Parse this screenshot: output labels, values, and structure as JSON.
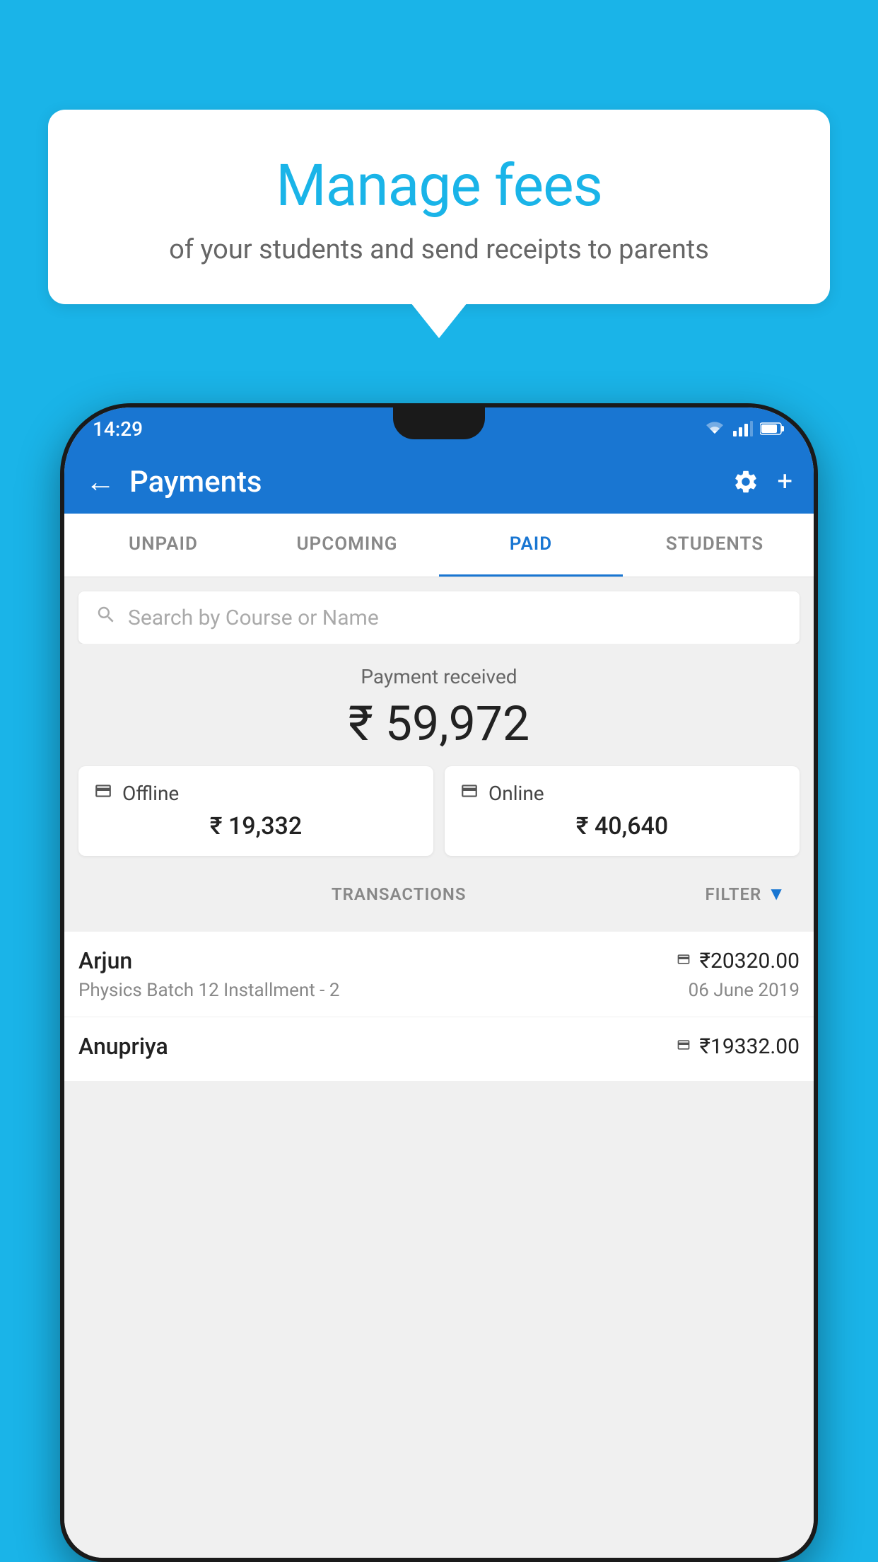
{
  "bubble": {
    "title": "Manage fees",
    "subtitle": "of your students and send receipts to parents"
  },
  "statusBar": {
    "time": "14:29",
    "icons": [
      "wifi",
      "signal",
      "battery"
    ]
  },
  "appBar": {
    "title": "Payments",
    "backLabel": "←",
    "settingsLabel": "⚙",
    "addLabel": "+"
  },
  "tabs": [
    {
      "label": "UNPAID",
      "active": false
    },
    {
      "label": "UPCOMING",
      "active": false
    },
    {
      "label": "PAID",
      "active": true
    },
    {
      "label": "STUDENTS",
      "active": false
    }
  ],
  "search": {
    "placeholder": "Search by Course or Name"
  },
  "paymentSummary": {
    "label": "Payment received",
    "amount": "₹ 59,972",
    "offline": {
      "label": "Offline",
      "amount": "₹ 19,332"
    },
    "online": {
      "label": "Online",
      "amount": "₹ 40,640"
    }
  },
  "transactions": {
    "sectionLabel": "TRANSACTIONS",
    "filterLabel": "FILTER",
    "items": [
      {
        "name": "Arjun",
        "description": "Physics Batch 12 Installment - 2",
        "amount": "₹20320.00",
        "date": "06 June 2019",
        "type": "online"
      },
      {
        "name": "Anupriya",
        "description": "",
        "amount": "₹19332.00",
        "date": "",
        "type": "offline"
      }
    ]
  }
}
